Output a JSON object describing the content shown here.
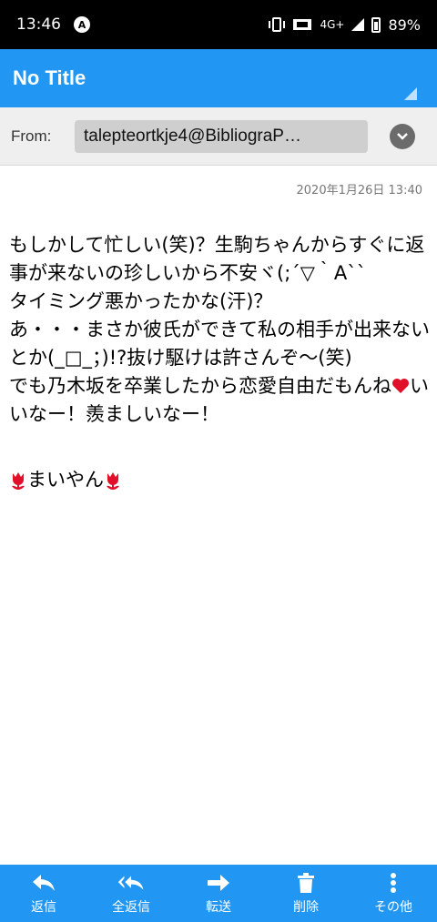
{
  "status_bar": {
    "time": "13:46",
    "network": "4G+",
    "battery": "89%",
    "icons": [
      "a-icon",
      "vibrate-icon",
      "data-icon",
      "signal-icon",
      "battery-icon"
    ]
  },
  "app_bar": {
    "title": "No Title"
  },
  "from": {
    "label": "From:",
    "value": "talepteortkje4@BibliograP…"
  },
  "message": {
    "date": "2020年1月26日 13:40",
    "lines": [
      "もしかして忙しい(笑)？生駒ちゃんからすぐに返事が来ないの珍しいから不安ヾ(;´▽｀A``",
      "タイミング悪かったかな(汗)？",
      "あ・・・まさか彼氏ができて私の相手が出来ないとか(_□_；)!?抜け駆けは許さんぞ〜(笑)"
    ],
    "line4_a": "でも乃木坂を卒業したから恋愛自由だもんね",
    "line4_b": "いいなー！羨ましいなー！",
    "signature": "まいやん"
  },
  "bottom_nav": [
    {
      "label": "返信",
      "icon": "reply-icon"
    },
    {
      "label": "全返信",
      "icon": "reply-all-icon"
    },
    {
      "label": "転送",
      "icon": "forward-icon"
    },
    {
      "label": "削除",
      "icon": "delete-icon"
    },
    {
      "label": "その他",
      "icon": "more-icon"
    }
  ],
  "colors": {
    "accent": "#2196f3",
    "heart": "#e0102a",
    "tulip": "#e0102a"
  }
}
